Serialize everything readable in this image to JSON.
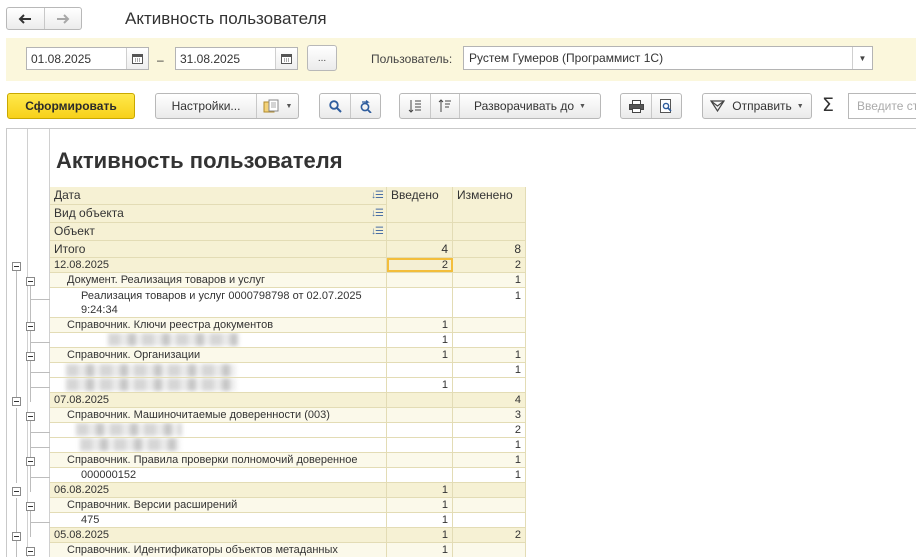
{
  "window": {
    "title": "Активность пользователя",
    "back_icon": "arrow-left-icon",
    "forward_icon": "arrow-right-icon"
  },
  "filters": {
    "date_from": "01.08.2025",
    "date_separator": "–",
    "date_to": "31.08.2025",
    "period_button_label": "...",
    "user_label": "Пользователь:",
    "user_value": "Рустем Гумеров (Программист 1С)"
  },
  "toolbar": {
    "generate_label": "Сформировать",
    "settings_label": "Настройки...",
    "expand_label": "Разворачивать до",
    "send_label": "Отправить",
    "sum_symbol": "Σ",
    "search_placeholder": "Введите ст"
  },
  "report": {
    "title": "Активность пользователя",
    "header": {
      "group_col_1": "Дата",
      "group_col_2": "Вид объекта",
      "group_col_3": "Объект",
      "col_entered": "Введено",
      "col_changed": "Изменено"
    },
    "total": {
      "label": "Итого",
      "entered": "4",
      "changed": "8"
    },
    "rows": [
      {
        "label": "12.08.2025",
        "entered": "2",
        "changed": "2"
      },
      {
        "label": "Документ. Реализация товаров и услуг",
        "entered": "",
        "changed": "1"
      },
      {
        "label": "Реализация товаров и услуг 0000798798 от 02.07.2025",
        "label2": "9:24:34",
        "entered": "",
        "changed": "1"
      },
      {
        "label": "Справочник. Ключи реестра документов",
        "entered": "1",
        "changed": ""
      },
      {
        "label": "",
        "entered": "1",
        "changed": ""
      },
      {
        "label": "Справочник. Организации",
        "entered": "1",
        "changed": "1"
      },
      {
        "label": "",
        "entered": "",
        "changed": "1"
      },
      {
        "label": "",
        "entered": "1",
        "changed": ""
      },
      {
        "label": "07.08.2025",
        "entered": "",
        "changed": "4"
      },
      {
        "label": "Справочник. Машиночитаемые доверенности (003)",
        "entered": "",
        "changed": "3"
      },
      {
        "label": "",
        "entered": "",
        "changed": "2"
      },
      {
        "label": "",
        "entered": "",
        "changed": "1"
      },
      {
        "label": "Справочник. Правила проверки полномочий доверенное",
        "entered": "",
        "changed": "1"
      },
      {
        "label": "000000152",
        "entered": "",
        "changed": "1"
      },
      {
        "label": "06.08.2025",
        "entered": "1",
        "changed": ""
      },
      {
        "label": "Справочник. Версии расширений",
        "entered": "1",
        "changed": ""
      },
      {
        "label": "475",
        "entered": "1",
        "changed": ""
      },
      {
        "label": "05.08.2025",
        "entered": "1",
        "changed": "2"
      },
      {
        "label": "Справочник. Идентификаторы объектов метаданных",
        "entered": "1",
        "changed": ""
      }
    ]
  }
}
